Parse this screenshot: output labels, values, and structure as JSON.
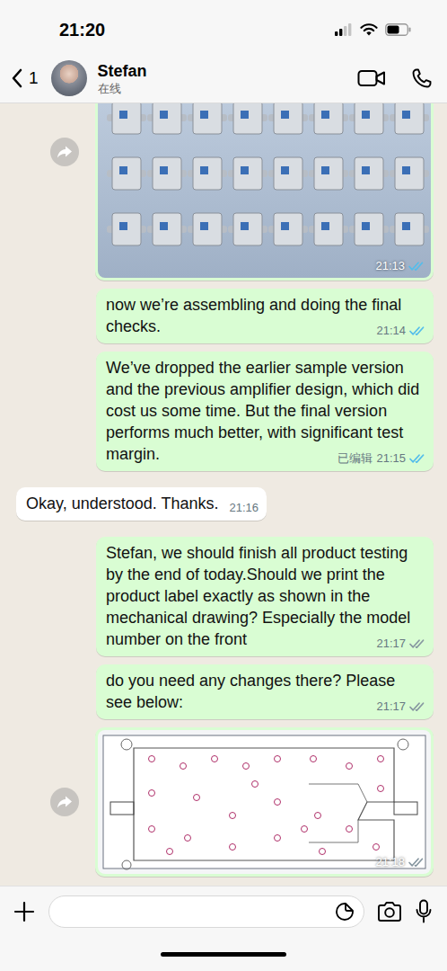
{
  "status_bar": {
    "time": "21:20",
    "signal_level": 0.5,
    "battery_level": 0.6
  },
  "header": {
    "unread_count": "1",
    "name": "Stefan",
    "subtitle": "在线"
  },
  "messages": [
    {
      "kind": "photo",
      "direction": "outgoing",
      "time": "21:13",
      "read": true
    },
    {
      "kind": "text",
      "direction": "outgoing",
      "text": "now we’re assembling and doing the final checks.",
      "time": "21:14",
      "read": true
    },
    {
      "kind": "text",
      "direction": "outgoing",
      "text": "We’ve dropped the earlier sample version and the previous amplifier design, which did cost us some time. But the final version performs much better, with significant test margin.",
      "edited": "已编辑",
      "time": "21:15",
      "read": true
    },
    {
      "kind": "text",
      "direction": "incoming",
      "text": "Okay, understood. Thanks.",
      "time": "21:16"
    },
    {
      "kind": "text",
      "direction": "outgoing",
      "text": "Stefan, we should finish all product testing by the end of today.Should we print the product label exactly as shown in the mechanical drawing? Especially the model number on the front",
      "time": "21:17",
      "read": false
    },
    {
      "kind": "text",
      "direction": "outgoing",
      "text": "do you need any changes there? Please see below:",
      "time": "21:17",
      "read": false
    },
    {
      "kind": "drawing",
      "direction": "outgoing",
      "time": "21:18",
      "read": false
    }
  ]
}
